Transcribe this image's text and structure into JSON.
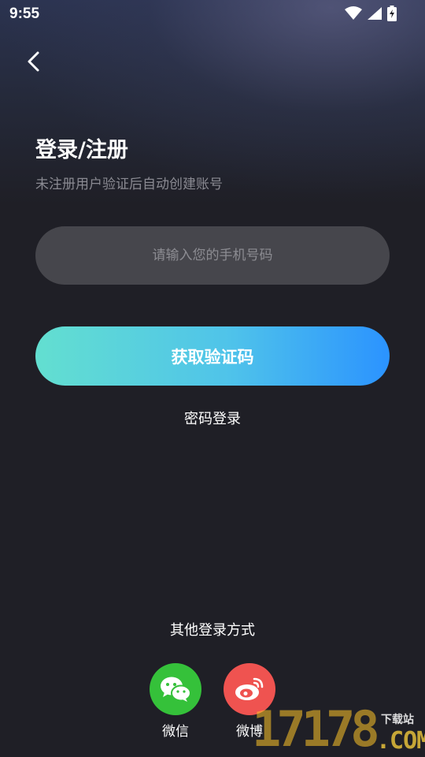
{
  "status_bar": {
    "time": "9:55"
  },
  "header": {
    "back_icon": "chevron-left-icon"
  },
  "login": {
    "title": "登录/注册",
    "subtitle": "未注册用户验证后自动创建账号",
    "phone_placeholder": "请输入您的手机号码",
    "phone_value": "",
    "get_code_label": "获取验证码",
    "password_login_label": "密码登录"
  },
  "other_login": {
    "label": "其他登录方式",
    "options": [
      {
        "label": "微信",
        "icon": "wechat-icon",
        "color": "#35c13a"
      },
      {
        "label": "微博",
        "icon": "weibo-icon",
        "color": "#ef5350"
      }
    ]
  },
  "watermark": {
    "digits": "17178",
    "suffix": ".COM",
    "small": "下载站"
  },
  "colors": {
    "background": "#1f1f26",
    "input_bg": "#46464c",
    "gradient_start": "#63dfd0",
    "gradient_end": "#2b93ff"
  }
}
